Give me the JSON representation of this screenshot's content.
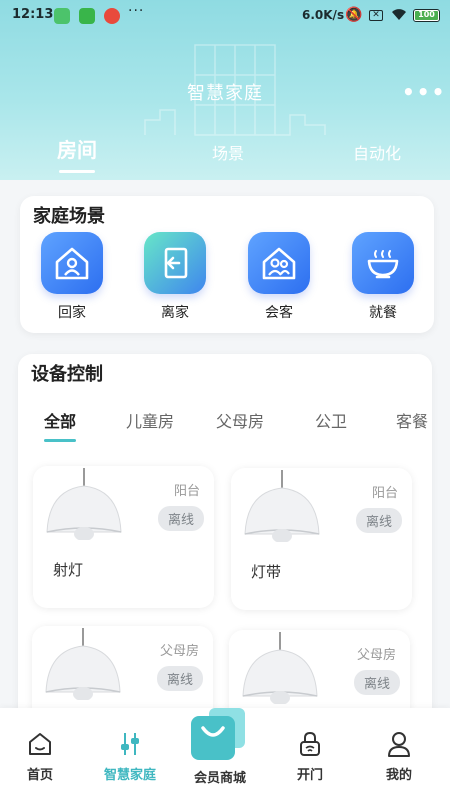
{
  "status_bar": {
    "time": "12:13",
    "dots": "···",
    "speed": "6.0K/s",
    "battery": "100"
  },
  "header": {
    "title": "智慧家庭",
    "more": "•••"
  },
  "top_tabs": [
    {
      "label": "房间",
      "active": true
    },
    {
      "label": "场景",
      "active": false
    },
    {
      "label": "自动化",
      "active": false
    }
  ],
  "scenes": {
    "title": "家庭场景",
    "items": [
      {
        "label": "回家",
        "icon": "home-person-icon"
      },
      {
        "label": "离家",
        "icon": "door-exit-icon"
      },
      {
        "label": "会客",
        "icon": "home-guests-icon"
      },
      {
        "label": "就餐",
        "icon": "bowl-icon"
      }
    ]
  },
  "devices": {
    "title": "设备控制",
    "tabs": [
      {
        "label": "全部",
        "active": true
      },
      {
        "label": "儿童房",
        "active": false
      },
      {
        "label": "父母房",
        "active": false
      },
      {
        "label": "公卫",
        "active": false
      },
      {
        "label": "客餐",
        "active": false
      }
    ],
    "items": [
      {
        "name": "射灯",
        "room": "阳台",
        "status": "离线"
      },
      {
        "name": "灯带",
        "room": "阳台",
        "status": "离线"
      },
      {
        "name": "",
        "room": "父母房",
        "status": "离线"
      },
      {
        "name": "",
        "room": "父母房",
        "status": "离线"
      }
    ]
  },
  "bottom_nav": [
    {
      "label": "首页",
      "icon": "home-icon",
      "active": false
    },
    {
      "label": "智慧家庭",
      "icon": "sliders-icon",
      "active": true
    },
    {
      "label": "会员商城",
      "icon": "shopping-bag-icon",
      "active": false
    },
    {
      "label": "开门",
      "icon": "lock-icon",
      "active": false
    },
    {
      "label": "我的",
      "icon": "person-icon",
      "active": false
    }
  ],
  "colors": {
    "accent": "#3fb7c0",
    "header_top": "#8fdbe2",
    "scene_icon": "#3f7ef0"
  }
}
